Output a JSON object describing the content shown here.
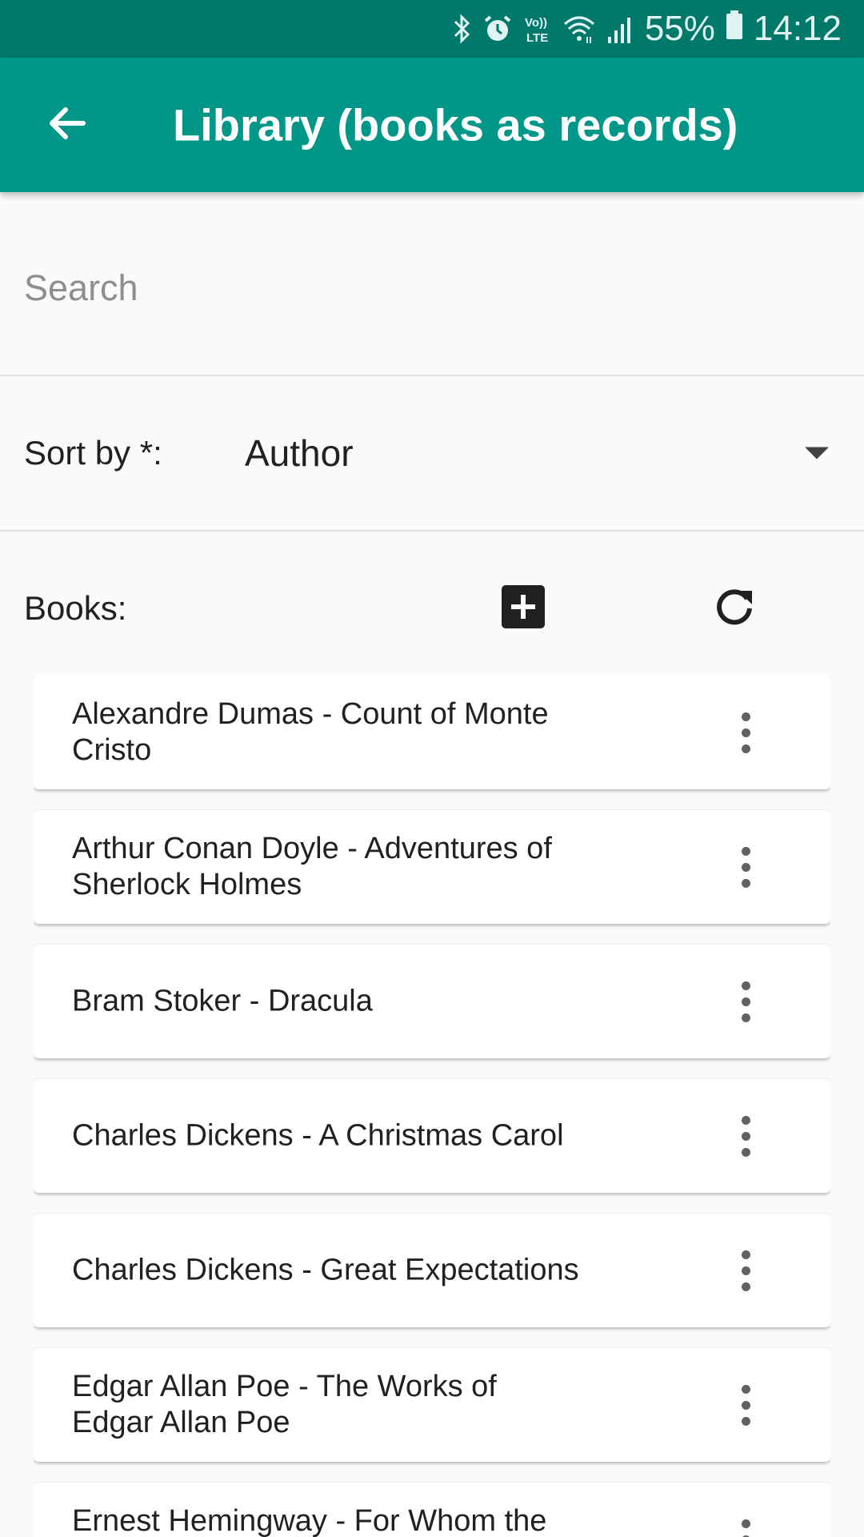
{
  "status_bar": {
    "battery": "55%",
    "time": "14:12",
    "icons": [
      "bluetooth-icon",
      "alarm-icon",
      "volte-icon",
      "wifi-icon",
      "signal-icon",
      "battery-icon"
    ],
    "volte_text": "Vo)) LTE"
  },
  "app_bar": {
    "title": "Library (books as records)",
    "back_icon": "arrow-left-icon"
  },
  "search": {
    "placeholder": "Search",
    "value": ""
  },
  "sort": {
    "label": "Sort by *:",
    "selected": "Author"
  },
  "books_section": {
    "label": "Books:",
    "add_icon": "add-box-icon",
    "refresh_icon": "refresh-icon"
  },
  "books": [
    "Alexandre Dumas - Count of Monte Cristo",
    "Arthur Conan Doyle - Adventures of Sherlock Holmes",
    "Bram Stoker - Dracula",
    "Charles Dickens - A Christmas Carol",
    "Charles Dickens - Great Expectations",
    "Edgar Allan Poe - The Works of Edgar Allan Poe",
    "Ernest Hemingway - For Whom the Bell Tolls"
  ],
  "colors": {
    "status_bar": "#00796b",
    "app_bar": "#009688",
    "background": "#fafafa"
  }
}
